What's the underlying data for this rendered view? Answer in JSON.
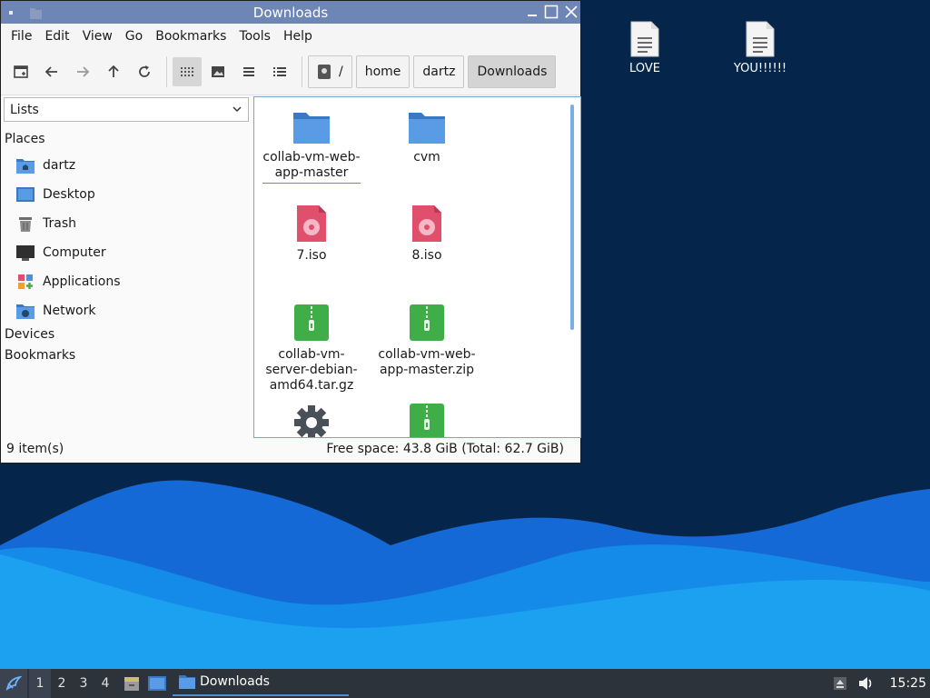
{
  "window": {
    "title": "Downloads",
    "menu": [
      "File",
      "Edit",
      "View",
      "Go",
      "Bookmarks",
      "Tools",
      "Help"
    ],
    "breadcrumb": [
      "/",
      "home",
      "dartz",
      "Downloads"
    ],
    "sidebar": {
      "view_select": "Lists",
      "places_header": "Places",
      "places": [
        "dartz",
        "Desktop",
        "Trash",
        "Computer",
        "Applications",
        "Network"
      ],
      "devices_header": "Devices",
      "bookmarks_header": "Bookmarks"
    },
    "files": [
      {
        "name": "collab-vm-web-app-master",
        "lines": [
          "collab-vm-web-",
          "app-master"
        ],
        "icon": "folder-icon"
      },
      {
        "name": "cvm",
        "lines": [
          "cvm"
        ],
        "icon": "folder-icon"
      },
      {
        "name": "7.iso",
        "lines": [
          "7.iso"
        ],
        "icon": "disc-image-icon"
      },
      {
        "name": "8.iso",
        "lines": [
          "8.iso"
        ],
        "icon": "disc-image-icon"
      },
      {
        "name": "collab-vm-server-debian-amd64.tar.gz",
        "lines": [
          "collab-vm-",
          "server-debian-",
          "amd64.tar.gz"
        ],
        "icon": "archive-icon"
      },
      {
        "name": "collab-vm-web-app-master.zip",
        "lines": [
          "collab-vm-web-",
          "app-master.zip"
        ],
        "icon": "archive-icon"
      },
      {
        "name": "",
        "lines": [],
        "icon": "executable-gear-icon"
      },
      {
        "name": "",
        "lines": [],
        "icon": "archive-icon"
      }
    ],
    "status": {
      "count": "9 item(s)",
      "free_space": "Free space: 43.8 GiB (Total: 62.7 GiB)"
    }
  },
  "desktop_icons": [
    "LOVE",
    "YOU!!!!!!"
  ],
  "taskbar": {
    "workspaces": [
      "1",
      "2",
      "3",
      "4"
    ],
    "task_label": "Downloads",
    "clock": "15:25"
  },
  "colors": {
    "desktop_bg": "#05264a",
    "titlebar": "#6e86b6",
    "folder": "#4a8fe0",
    "iso": "#e0506c",
    "archive": "#3fae49",
    "taskbar": "#2d333b"
  }
}
